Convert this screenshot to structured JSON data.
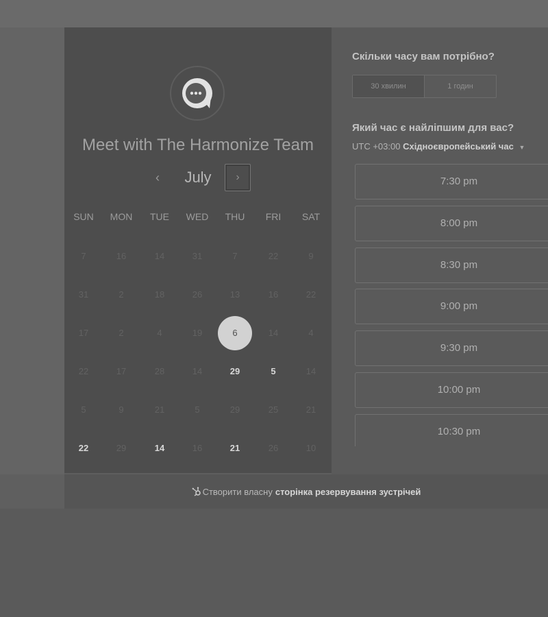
{
  "booking": {
    "title": "Meet with The Harmonize Team",
    "month": "July",
    "prev": "‹",
    "next": "›",
    "weekdays": [
      "SUN",
      "MON",
      "TUE",
      "WED",
      "THU",
      "FRI",
      "SAT"
    ],
    "weeks": [
      [
        "7",
        "16",
        "14",
        "31",
        "7",
        "22",
        "9"
      ],
      [
        "31",
        "2",
        "18",
        "26",
        "13",
        "16",
        "22"
      ],
      [
        "17",
        "2",
        "4",
        "19",
        "6",
        "14",
        "4"
      ],
      [
        "22",
        "17",
        "28",
        "14",
        "29",
        "5",
        "14"
      ],
      [
        "5",
        "9",
        "21",
        "5",
        "29",
        "25",
        "21"
      ],
      [
        "22",
        "29",
        "14",
        "16",
        "21",
        "26",
        "10"
      ]
    ],
    "selected_day": "6"
  },
  "right": {
    "duration_question": "Скільки часу вам потрібно?",
    "durations": [
      "30 хвилин",
      "1 годин"
    ],
    "time_question": "Який час є найліпшим для вас?",
    "tz_offset": "UTC +03:00",
    "tz_name": "Східноєвропейський час",
    "slots": [
      "7:30 pm",
      "8:00 pm",
      "8:30 pm",
      "9:00 pm",
      "9:30 pm",
      "10:00 pm",
      "10:30 pm"
    ]
  },
  "footer": {
    "prefix": "Створити власну",
    "bold": "сторінка резервування зустрічей"
  }
}
